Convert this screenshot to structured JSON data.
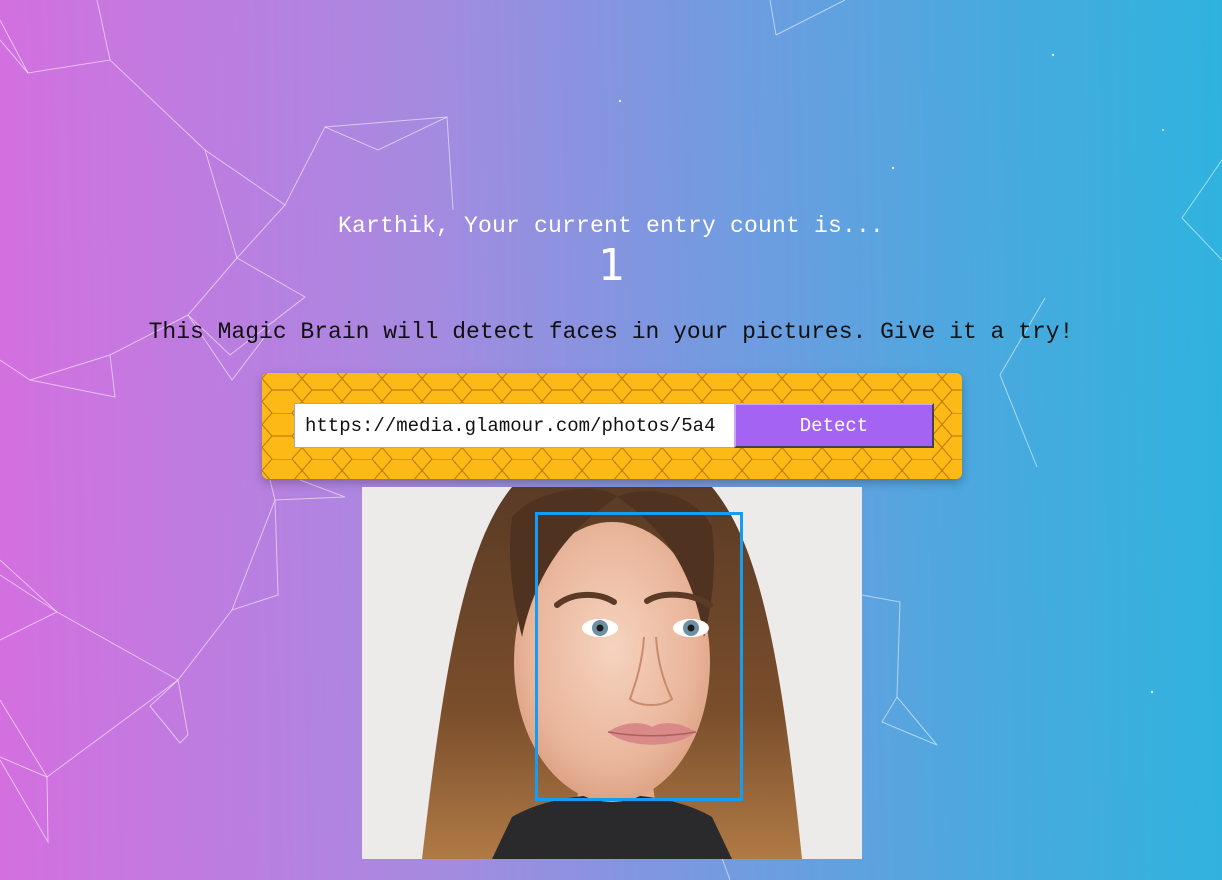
{
  "rank": {
    "message": "Karthik, Your current entry count is...",
    "count": "1"
  },
  "intro": {
    "text": "This Magic Brain will detect faces in your pictures. Give it a try!"
  },
  "image_form": {
    "url_value": "https://media.glamour.com/photos/5a4",
    "detect_label": "Detect"
  },
  "colors": {
    "panel": "#fdb915",
    "button": "#a463f2",
    "bounding_box": "#149df2"
  },
  "face_image": {
    "description": "portrait photo with detected face"
  }
}
